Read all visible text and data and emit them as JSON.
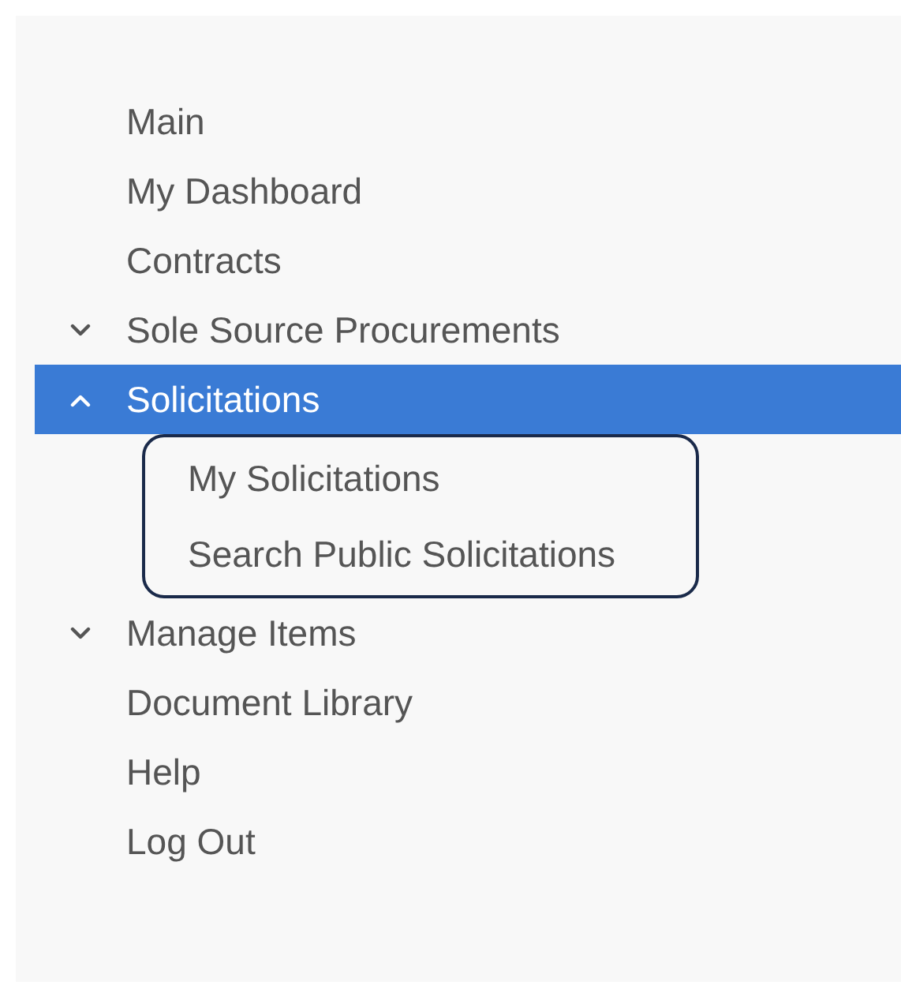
{
  "menu": [
    {
      "label": "Main",
      "selected": false
    },
    {
      "label": "My Dashboard",
      "selected": false
    },
    {
      "label": "Contracts",
      "selected": false
    },
    {
      "label": "Sole Source Procurements",
      "selected": false,
      "expanded": false
    },
    {
      "label": "Solicitations",
      "selected": true,
      "expanded": true,
      "children": [
        {
          "label": "My Solicitations",
          "selected": false
        },
        {
          "label": "Search Public Solicitations",
          "selected": false
        }
      ]
    },
    {
      "label": "Manage Items",
      "selected": false,
      "expanded": false
    },
    {
      "label": "Document Library",
      "selected": false
    },
    {
      "label": "Help",
      "selected": false
    },
    {
      "label": "Log Out",
      "selected": false
    }
  ]
}
